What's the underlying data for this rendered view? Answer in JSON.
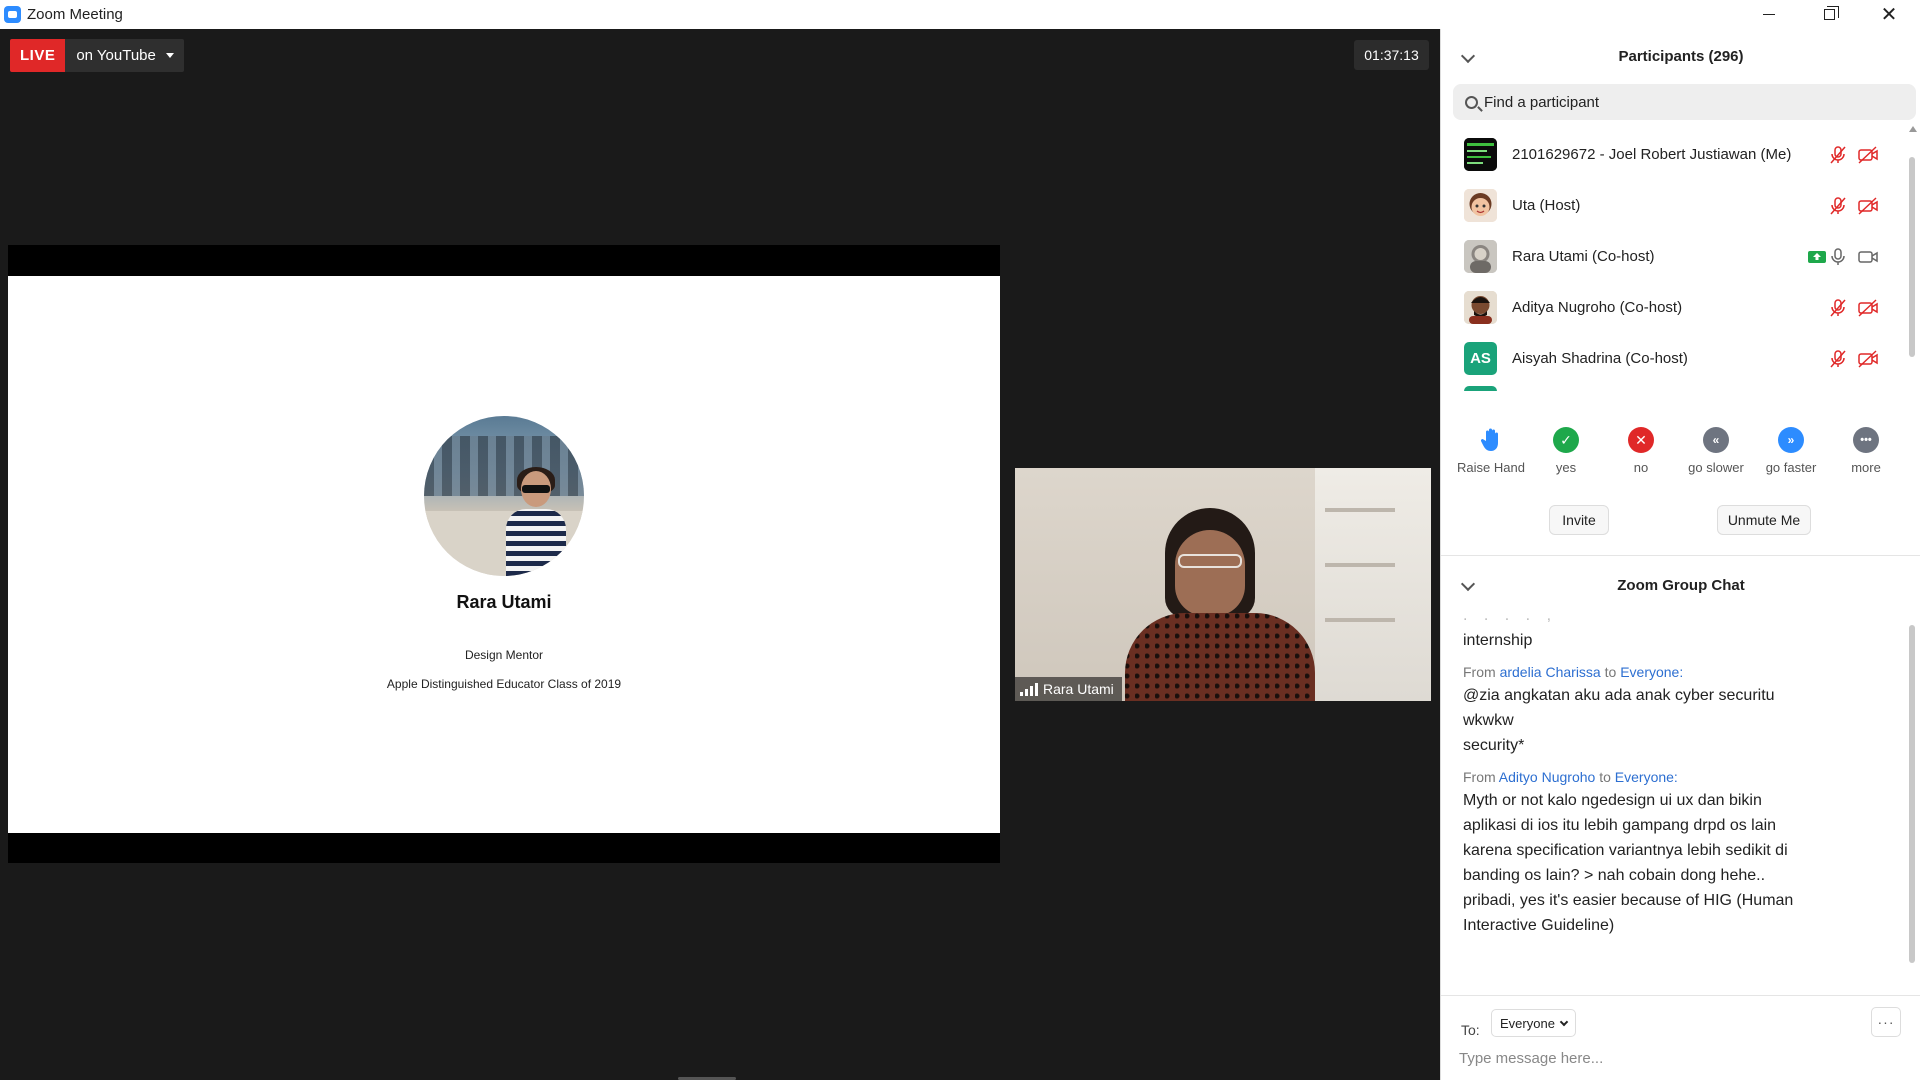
{
  "window": {
    "title": "Zoom Meeting",
    "minimize_icon": "minimize-icon",
    "maximize_icon": "restore-icon",
    "close_icon": "close-icon"
  },
  "stage": {
    "live_label": "LIVE",
    "live_target": "on YouTube",
    "timer": "01:37:13"
  },
  "slide": {
    "name": "Rara Utami",
    "role": "Design Mentor",
    "award": "Apple Distinguished Educator Class of 2019"
  },
  "speaker_tile": {
    "name": "Rara Utami"
  },
  "participants": {
    "header": "Participants (296)",
    "search_placeholder": "Find a participant",
    "list": [
      {
        "name": "2101629672 - Joel Robert Justiawan (Me)",
        "avatar": "image",
        "mic": "muted",
        "video": "off"
      },
      {
        "name": "Uta (Host)",
        "avatar": "image",
        "mic": "muted",
        "video": "off"
      },
      {
        "name": "Rara Utami (Co-host)",
        "avatar": "image",
        "share": "sharing",
        "mic": "on",
        "video": "on"
      },
      {
        "name": "Aditya Nugroho (Co-host)",
        "avatar": "image",
        "mic": "muted",
        "video": "off"
      },
      {
        "name": "Aisyah Shadrina (Co-host)",
        "avatar": "AS",
        "avatar_color": "#1aa37a",
        "mic": "muted",
        "video": "off"
      }
    ],
    "reactions": [
      {
        "label": "Raise Hand",
        "icon": "raise-hand-icon",
        "color": "#2d8cff"
      },
      {
        "label": "yes",
        "icon": "check-icon",
        "color": "#1ea84b"
      },
      {
        "label": "no",
        "icon": "x-icon",
        "color": "#e02828"
      },
      {
        "label": "go slower",
        "icon": "rewind-icon",
        "color": "#6e7480"
      },
      {
        "label": "go faster",
        "icon": "fast-forward-icon",
        "color": "#2d8cff"
      },
      {
        "label": "more",
        "icon": "more-icon",
        "color": "#6e7480"
      }
    ],
    "invite_label": "Invite",
    "unmute_label": "Unmute Me"
  },
  "chat": {
    "header": "Zoom Group Chat",
    "messages": [
      {
        "from": "",
        "to": "",
        "lines": [
          "internship"
        ]
      },
      {
        "from": "ardelia Charissa",
        "to": "Everyone:",
        "lines": [
          "@zia angkatan aku ada anak cyber securitu",
          "wkwkw",
          "security*"
        ]
      },
      {
        "from": "Adityo Nugroho",
        "to": "Everyone:",
        "lines": [
          "Myth or not kalo ngedesign ui ux dan bikin",
          "aplikasi di ios itu lebih gampang drpd os lain",
          "karena specification variantnya lebih sedikit di",
          "banding os lain? > nah cobain dong hehe..",
          "pribadi, yes it's easier because of HIG (Human",
          "Interactive Guideline)"
        ]
      }
    ],
    "from_prefix": "From",
    "to_word": "to",
    "to_label": "To:",
    "to_value": "Everyone",
    "more_label": "···",
    "input_placeholder": "Type message here..."
  }
}
